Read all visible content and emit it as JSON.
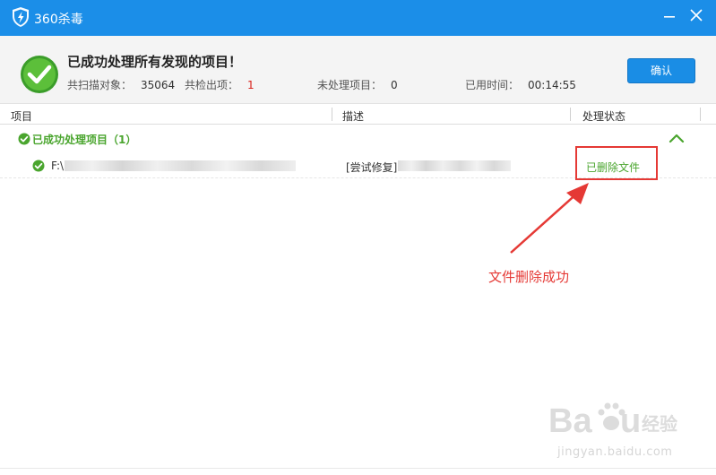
{
  "window": {
    "title": "360杀毒",
    "logo_icon": "shield-lightning-icon",
    "accent_color": "#1b8ee8"
  },
  "summary": {
    "headline": "已成功处理所有发现的项目！",
    "scanned_label": "共扫描对象：",
    "scanned_value": "35064",
    "found_label": "共检出项：",
    "found_value": "1",
    "unhandled_label": "未处理项目：",
    "unhandled_value": "0",
    "time_label": "已用时间：",
    "time_value": "00:14:55",
    "confirm_label": "确认",
    "status_icon": "check-circle-icon"
  },
  "columns": {
    "item": "项目",
    "description": "描述",
    "status": "处理状态"
  },
  "group": {
    "label": "已成功处理项目（1）"
  },
  "rows": [
    {
      "path": "F:\\",
      "description": "[尝试修复]",
      "status": "已删除文件"
    }
  ],
  "annotation": {
    "note": "文件删除成功",
    "color": "#e53935"
  },
  "watermark": {
    "brand": "Baidu经验",
    "url": "jingyan.baidu.com"
  }
}
